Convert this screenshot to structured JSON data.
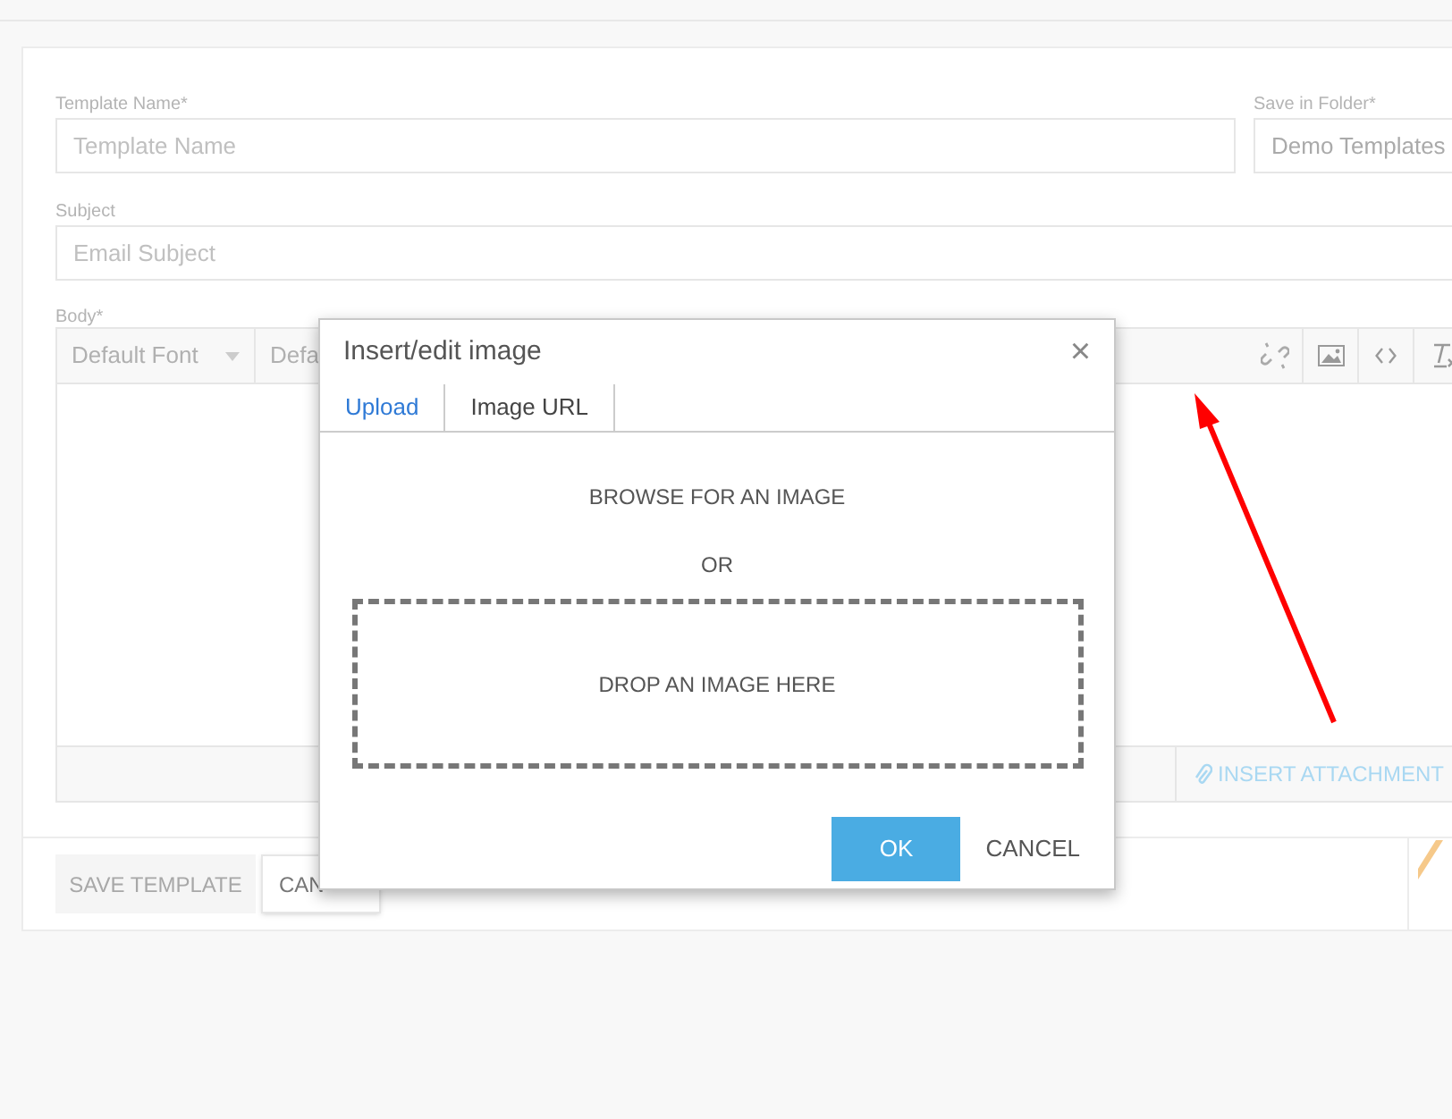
{
  "form": {
    "template_name": {
      "label": "Template Name*",
      "placeholder": "Template Name"
    },
    "folder": {
      "label": "Save in Folder*",
      "value": "Demo Templates"
    },
    "subject": {
      "label": "Subject",
      "placeholder": "Email Subject"
    },
    "body": {
      "label": "Body*",
      "font_select": "Default Font",
      "size_select": "Defa",
      "insert_attachment": "INSERT ATTACHMENT"
    },
    "buttons": [
      {
        "label": "SAVE TEMPLATE",
        "disabled": true
      },
      {
        "label": "CAN",
        "disabled": false
      }
    ]
  },
  "dialog": {
    "title": "Insert/edit image",
    "close": "×",
    "tabs": [
      {
        "label": "Upload",
        "selected": true
      },
      {
        "label": "Image URL",
        "selected": false
      }
    ],
    "browse": "BROWSE FOR AN IMAGE",
    "or": "OR",
    "drop": "DROP AN IMAGE HERE",
    "ok": "OK",
    "cancel": "CANCEL"
  }
}
